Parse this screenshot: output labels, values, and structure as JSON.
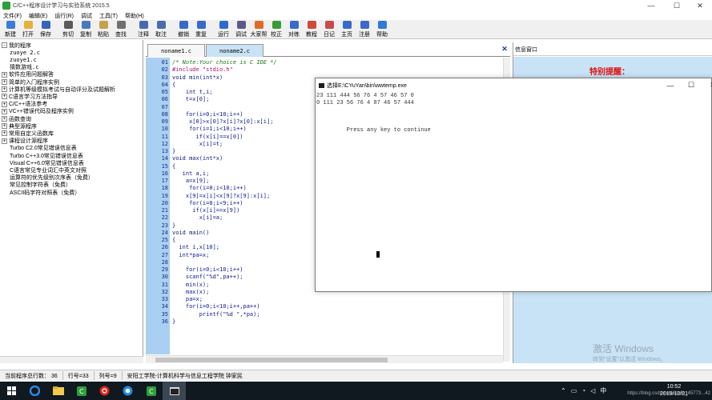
{
  "window": {
    "title": "C/C++程序设计学习与实验系统 2015.5",
    "minimize": "—",
    "maximize": "☐",
    "close": "✕"
  },
  "menu": [
    "文件(F)",
    "编辑(E)",
    "运行(R)",
    "调试",
    "工具(T)",
    "帮助(H)"
  ],
  "toolbar": [
    {
      "label": "新建",
      "color": "#3a7dd8"
    },
    {
      "label": "打开",
      "color": "#e2b33a"
    },
    {
      "label": "保存",
      "color": "#3a62b8"
    },
    {
      "label": "剪切",
      "color": "#5a5a5a"
    },
    {
      "label": "复制",
      "color": "#4a78c0"
    },
    {
      "label": "粘贴",
      "color": "#c8a04a"
    },
    {
      "label": "查找",
      "color": "#707070"
    },
    {
      "label": "注释",
      "color": "#4a6ab0"
    },
    {
      "label": "取注",
      "color": "#4a6ab0"
    },
    {
      "label": "撤销",
      "color": "#3a6ac8"
    },
    {
      "label": "重复",
      "color": "#3a6ac8"
    },
    {
      "label": "运行",
      "color": "#2e6ad0"
    },
    {
      "label": "调试",
      "color": "#5a5a8a"
    },
    {
      "label": "大家帮",
      "color": "#e06a2a"
    },
    {
      "label": "校正",
      "color": "#3a9a3a"
    },
    {
      "label": "对练",
      "color": "#3a6ac8"
    },
    {
      "label": "教程",
      "color": "#d04a3a"
    },
    {
      "label": "日记",
      "color": "#c84a4a"
    },
    {
      "label": "主页",
      "color": "#3a6ac8"
    },
    {
      "label": "注册",
      "color": "#3a6ac8"
    },
    {
      "label": "帮助",
      "color": "#2e7ad8"
    }
  ],
  "tree": [
    {
      "indent": 0,
      "exp": "-",
      "label": "我的程序",
      "mono": false
    },
    {
      "indent": 1,
      "exp": "",
      "label": "zuoye 2.c",
      "mono": true
    },
    {
      "indent": 1,
      "exp": "",
      "label": "zuoye1.c",
      "mono": true
    },
    {
      "indent": 1,
      "exp": "",
      "label": "猜数游戏.c",
      "mono": true
    },
    {
      "indent": 0,
      "exp": "+",
      "label": "软件应用问题解答",
      "mono": false
    },
    {
      "indent": 0,
      "exp": "+",
      "label": "简单的入门程序实例",
      "mono": false
    },
    {
      "indent": 0,
      "exp": "+",
      "label": "计算机等级模拟考试与自动评分及试题解析",
      "mono": false
    },
    {
      "indent": 0,
      "exp": "+",
      "label": "C语言学习方法指导",
      "mono": false
    },
    {
      "indent": 0,
      "exp": "+",
      "label": "C/C++语法参考",
      "mono": false
    },
    {
      "indent": 0,
      "exp": "+",
      "label": "VC++错误代码及程序实例",
      "mono": false
    },
    {
      "indent": 0,
      "exp": "+",
      "label": "函数查询",
      "mono": false
    },
    {
      "indent": 0,
      "exp": "+",
      "label": "典型源程序",
      "mono": false
    },
    {
      "indent": 0,
      "exp": "+",
      "label": "常用自定义函数库",
      "mono": false
    },
    {
      "indent": 0,
      "exp": "+",
      "label": "课程设计源程序",
      "mono": false
    },
    {
      "indent": 1,
      "exp": "",
      "label": "Turbo C2.0常见错误信息表",
      "mono": false
    },
    {
      "indent": 1,
      "exp": "",
      "label": "Turbo C++3.0常见错误信息表",
      "mono": false
    },
    {
      "indent": 1,
      "exp": "",
      "label": "Visual C++6.0常见错误信息表",
      "mono": false
    },
    {
      "indent": 1,
      "exp": "",
      "label": "C语言常见专业词汇中英文对照",
      "mono": false
    },
    {
      "indent": 1,
      "exp": "",
      "label": "运算符的优先级别次序表（免费）",
      "mono": false
    },
    {
      "indent": 1,
      "exp": "",
      "label": "常见控制字符表（免费）",
      "mono": false
    },
    {
      "indent": 1,
      "exp": "",
      "label": "ASCII码字符对照表（免费）",
      "mono": false
    }
  ],
  "editor": {
    "tabs": [
      "noname1.c",
      "noname2.c"
    ],
    "active_tab": 1,
    "close": "✕",
    "lines": [
      {
        "n": "01",
        "text": "/* Note:Your choice is C IDE */",
        "kind": "comment"
      },
      {
        "n": "02",
        "text": "#include \"stdio.h\"",
        "kind": "string"
      },
      {
        "n": "03",
        "text": "void min(int*x)",
        "kind": "code"
      },
      {
        "n": "04",
        "text": "{",
        "kind": "code"
      },
      {
        "n": "05",
        "text": "    int t,i;",
        "kind": "code"
      },
      {
        "n": "06",
        "text": "    t=x[0];",
        "kind": "code"
      },
      {
        "n": "07",
        "text": "",
        "kind": "code"
      },
      {
        "n": "08",
        "text": "    for(i=0;i<10;i++)",
        "kind": "code"
      },
      {
        "n": "09",
        "text": "     x[0]>x[0]?x[i]?x[0]:x[i];",
        "kind": "code"
      },
      {
        "n": "10",
        "text": "     for(i=1;i<10;i++)",
        "kind": "code"
      },
      {
        "n": "11",
        "text": "       if(x[i]==x[0])",
        "kind": "code"
      },
      {
        "n": "12",
        "text": "        x[i]=t;",
        "kind": "code"
      },
      {
        "n": "13",
        "text": "}",
        "kind": "code"
      },
      {
        "n": "14",
        "text": "void max(int*x)",
        "kind": "code"
      },
      {
        "n": "15",
        "text": "{",
        "kind": "code"
      },
      {
        "n": "16",
        "text": "   int a,i;",
        "kind": "code"
      },
      {
        "n": "17",
        "text": "    a=x[9];",
        "kind": "code"
      },
      {
        "n": "18",
        "text": "     for(i=0;i<10;i++)",
        "kind": "code"
      },
      {
        "n": "19",
        "text": "    x[9]=x[i]<x[9]?x[9]:x[i];",
        "kind": "code"
      },
      {
        "n": "20",
        "text": "     for(i=0;i<9;i++)",
        "kind": "code"
      },
      {
        "n": "21",
        "text": "      if(x[i]==x[9])",
        "kind": "code"
      },
      {
        "n": "22",
        "text": "        x[i]=a;",
        "kind": "code"
      },
      {
        "n": "23",
        "text": "}",
        "kind": "code"
      },
      {
        "n": "24",
        "text": "void main()",
        "kind": "code"
      },
      {
        "n": "25",
        "text": "{",
        "kind": "code"
      },
      {
        "n": "26",
        "text": "  int i,x[10];",
        "kind": "code"
      },
      {
        "n": "27",
        "text": "  int*pa=x;",
        "kind": "code"
      },
      {
        "n": "28",
        "text": "",
        "kind": "code"
      },
      {
        "n": "29",
        "text": "    for(i=0;i<10;i++)",
        "kind": "code"
      },
      {
        "n": "30",
        "text": "    scanf(\"%d\",pa++);",
        "kind": "code"
      },
      {
        "n": "31",
        "text": "    min(x);",
        "kind": "code"
      },
      {
        "n": "32",
        "text": "    max(x);",
        "kind": "code"
      },
      {
        "n": "33",
        "text": "    pa=x;",
        "kind": "code"
      },
      {
        "n": "34",
        "text": "    for(i=0;i<10;i++,pa++)",
        "kind": "code"
      },
      {
        "n": "35",
        "text": "        printf(\"%d \",*pa);",
        "kind": "code"
      },
      {
        "n": "36",
        "text": "}",
        "kind": "code"
      }
    ]
  },
  "info": {
    "title": "信息窗口",
    "warning": "特别提醒：",
    "watermark_line1": "激活 Windows",
    "watermark_line2": "转到\"设置\"以激活 Windows。"
  },
  "console": {
    "title": "选择E:\\CYuYan\\bin\\wwtemp.exe",
    "output": [
      "23 111 444 56 76 4 57 46 57 0",
      "0 111 23 56 76 4 87 46 57 444",
      "",
      "",
      "",
      "         Press any key to continue"
    ],
    "minimize": "—",
    "maximize": "☐",
    "close": "✕"
  },
  "status": {
    "total_lines": "当前程序总行数：  36",
    "row": "行号=33",
    "col": "列号=9",
    "org": "安阳工学院-计算机科学与信息工程学院    钟家民"
  },
  "taskbar": {
    "time": "10:52",
    "date": "2019/12/21",
    "url": "https://blog.csdn.net/weixin_45773...42"
  }
}
